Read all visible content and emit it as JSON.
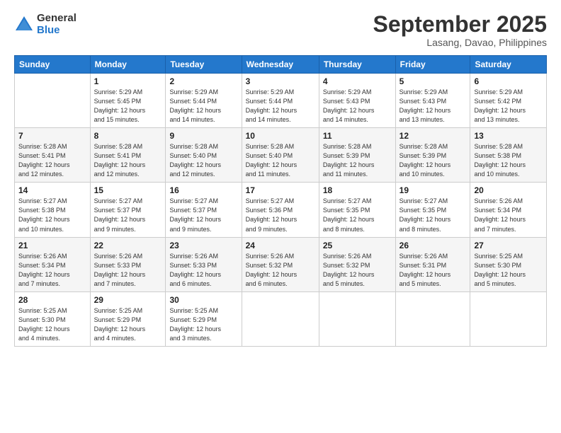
{
  "logo": {
    "general": "General",
    "blue": "Blue"
  },
  "title": "September 2025",
  "location": "Lasang, Davao, Philippines",
  "days_of_week": [
    "Sunday",
    "Monday",
    "Tuesday",
    "Wednesday",
    "Thursday",
    "Friday",
    "Saturday"
  ],
  "weeks": [
    [
      {
        "day": "",
        "info": ""
      },
      {
        "day": "1",
        "info": "Sunrise: 5:29 AM\nSunset: 5:45 PM\nDaylight: 12 hours\nand 15 minutes."
      },
      {
        "day": "2",
        "info": "Sunrise: 5:29 AM\nSunset: 5:44 PM\nDaylight: 12 hours\nand 14 minutes."
      },
      {
        "day": "3",
        "info": "Sunrise: 5:29 AM\nSunset: 5:44 PM\nDaylight: 12 hours\nand 14 minutes."
      },
      {
        "day": "4",
        "info": "Sunrise: 5:29 AM\nSunset: 5:43 PM\nDaylight: 12 hours\nand 14 minutes."
      },
      {
        "day": "5",
        "info": "Sunrise: 5:29 AM\nSunset: 5:43 PM\nDaylight: 12 hours\nand 13 minutes."
      },
      {
        "day": "6",
        "info": "Sunrise: 5:29 AM\nSunset: 5:42 PM\nDaylight: 12 hours\nand 13 minutes."
      }
    ],
    [
      {
        "day": "7",
        "info": "Sunrise: 5:28 AM\nSunset: 5:41 PM\nDaylight: 12 hours\nand 12 minutes."
      },
      {
        "day": "8",
        "info": "Sunrise: 5:28 AM\nSunset: 5:41 PM\nDaylight: 12 hours\nand 12 minutes."
      },
      {
        "day": "9",
        "info": "Sunrise: 5:28 AM\nSunset: 5:40 PM\nDaylight: 12 hours\nand 12 minutes."
      },
      {
        "day": "10",
        "info": "Sunrise: 5:28 AM\nSunset: 5:40 PM\nDaylight: 12 hours\nand 11 minutes."
      },
      {
        "day": "11",
        "info": "Sunrise: 5:28 AM\nSunset: 5:39 PM\nDaylight: 12 hours\nand 11 minutes."
      },
      {
        "day": "12",
        "info": "Sunrise: 5:28 AM\nSunset: 5:39 PM\nDaylight: 12 hours\nand 10 minutes."
      },
      {
        "day": "13",
        "info": "Sunrise: 5:28 AM\nSunset: 5:38 PM\nDaylight: 12 hours\nand 10 minutes."
      }
    ],
    [
      {
        "day": "14",
        "info": "Sunrise: 5:27 AM\nSunset: 5:38 PM\nDaylight: 12 hours\nand 10 minutes."
      },
      {
        "day": "15",
        "info": "Sunrise: 5:27 AM\nSunset: 5:37 PM\nDaylight: 12 hours\nand 9 minutes."
      },
      {
        "day": "16",
        "info": "Sunrise: 5:27 AM\nSunset: 5:37 PM\nDaylight: 12 hours\nand 9 minutes."
      },
      {
        "day": "17",
        "info": "Sunrise: 5:27 AM\nSunset: 5:36 PM\nDaylight: 12 hours\nand 9 minutes."
      },
      {
        "day": "18",
        "info": "Sunrise: 5:27 AM\nSunset: 5:35 PM\nDaylight: 12 hours\nand 8 minutes."
      },
      {
        "day": "19",
        "info": "Sunrise: 5:27 AM\nSunset: 5:35 PM\nDaylight: 12 hours\nand 8 minutes."
      },
      {
        "day": "20",
        "info": "Sunrise: 5:26 AM\nSunset: 5:34 PM\nDaylight: 12 hours\nand 7 minutes."
      }
    ],
    [
      {
        "day": "21",
        "info": "Sunrise: 5:26 AM\nSunset: 5:34 PM\nDaylight: 12 hours\nand 7 minutes."
      },
      {
        "day": "22",
        "info": "Sunrise: 5:26 AM\nSunset: 5:33 PM\nDaylight: 12 hours\nand 7 minutes."
      },
      {
        "day": "23",
        "info": "Sunrise: 5:26 AM\nSunset: 5:33 PM\nDaylight: 12 hours\nand 6 minutes."
      },
      {
        "day": "24",
        "info": "Sunrise: 5:26 AM\nSunset: 5:32 PM\nDaylight: 12 hours\nand 6 minutes."
      },
      {
        "day": "25",
        "info": "Sunrise: 5:26 AM\nSunset: 5:32 PM\nDaylight: 12 hours\nand 5 minutes."
      },
      {
        "day": "26",
        "info": "Sunrise: 5:26 AM\nSunset: 5:31 PM\nDaylight: 12 hours\nand 5 minutes."
      },
      {
        "day": "27",
        "info": "Sunrise: 5:25 AM\nSunset: 5:30 PM\nDaylight: 12 hours\nand 5 minutes."
      }
    ],
    [
      {
        "day": "28",
        "info": "Sunrise: 5:25 AM\nSunset: 5:30 PM\nDaylight: 12 hours\nand 4 minutes."
      },
      {
        "day": "29",
        "info": "Sunrise: 5:25 AM\nSunset: 5:29 PM\nDaylight: 12 hours\nand 4 minutes."
      },
      {
        "day": "30",
        "info": "Sunrise: 5:25 AM\nSunset: 5:29 PM\nDaylight: 12 hours\nand 3 minutes."
      },
      {
        "day": "",
        "info": ""
      },
      {
        "day": "",
        "info": ""
      },
      {
        "day": "",
        "info": ""
      },
      {
        "day": "",
        "info": ""
      }
    ]
  ]
}
